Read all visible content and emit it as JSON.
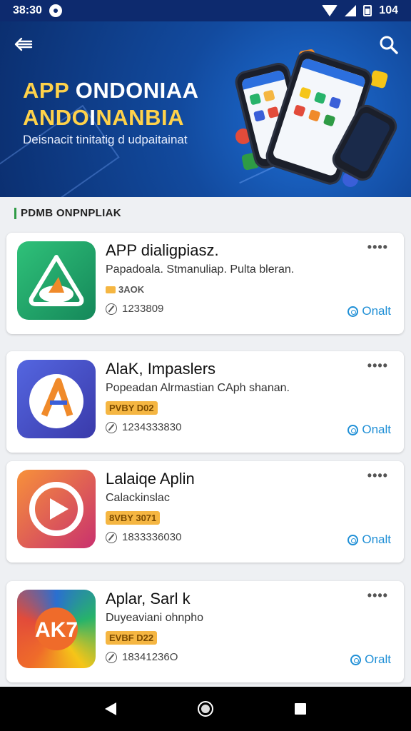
{
  "status_bar": {
    "time": "38:30",
    "battery": "104"
  },
  "hero": {
    "title_line1_a": "APP ",
    "title_line1_b": "ONDONIAA",
    "title_line2_a": "ANDO",
    "title_line2_b": "I",
    "title_line2_c": "NANBIA",
    "subtitle": "Deisnacit tinitatig d udpaitainat",
    "back_icon": "arrow-left-icon",
    "search_icon": "search-icon"
  },
  "section": {
    "title": "PDMB ONPNPLIAK",
    "accent_color": "#2e9b45"
  },
  "apps": [
    {
      "name": "APP dialigpiasz.",
      "description": "Papadoala. Stmanuliap. Pulta bleran.",
      "badge": "3AOK",
      "badge_style": "plain",
      "count": "1233809",
      "action": "Onalt",
      "icon_colors": [
        "#27b36a",
        "#1a8f58"
      ]
    },
    {
      "name": "AlaK, Impaslers",
      "description": "Popeadan Alrmastian CAph shanan.",
      "badge": "PVBY D02",
      "badge_style": "filled",
      "count": "1234333830",
      "action": "Onalt",
      "icon_colors": [
        "#4a5ed8",
        "#3d3fb0"
      ]
    },
    {
      "name": "Lalaiqe Aplin",
      "description": "Calackinslac",
      "badge": "8VBY 3071",
      "badge_style": "filled",
      "count": "1833336030",
      "action": "Onalt",
      "icon_colors": [
        "#f47a3a",
        "#c2346d"
      ]
    },
    {
      "name": "Aplar, Sarl k",
      "description": "Duyeaviani ohnpho",
      "badge": "EVBF D22",
      "badge_style": "filled",
      "count": "18341236O",
      "action": "Oralt",
      "icon_colors": [
        "#2a6fd0",
        "#ef6b2a"
      ]
    }
  ]
}
